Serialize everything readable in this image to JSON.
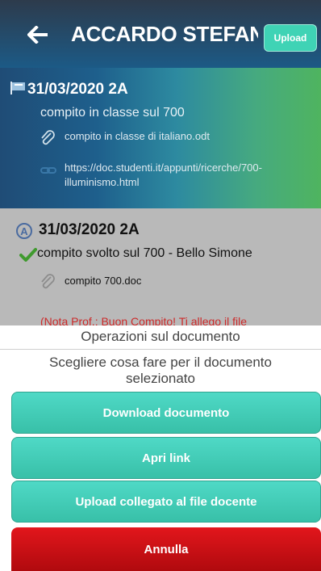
{
  "header": {
    "title": "ACCARDO STEFAN...",
    "upload_label": "Upload",
    "back_icon": "arrow-left-icon"
  },
  "items": [
    {
      "date": "31/03/2020  2A",
      "description": "compito in classe sul 700",
      "attachment": "compito in classe di italiano.odt",
      "link": "https://doc.studenti.it/appunti/ricerche/700-illuminismo.html",
      "icon": "flag-icon"
    },
    {
      "badge": "A",
      "date": "31/03/2020  2A",
      "description": "compito svolto sul 700 - Bello Simone",
      "attachment": "compito 700.doc",
      "note": "(Nota Prof.: Buon Compito! Ti allego il file",
      "icon": "checkmark-icon"
    }
  ],
  "action_sheet": {
    "title": "Operazioni sul documento",
    "message": "Scegliere cosa fare per il documento selezionato",
    "buttons": {
      "download": "Download documento",
      "open_link": "Apri link",
      "upload_linked": "Upload collegato al file docente",
      "cancel": "Annulla"
    }
  },
  "colors": {
    "accent_green": "#3fd3b5",
    "cancel_red": "#d01015",
    "note_red": "#cc2a2a"
  }
}
